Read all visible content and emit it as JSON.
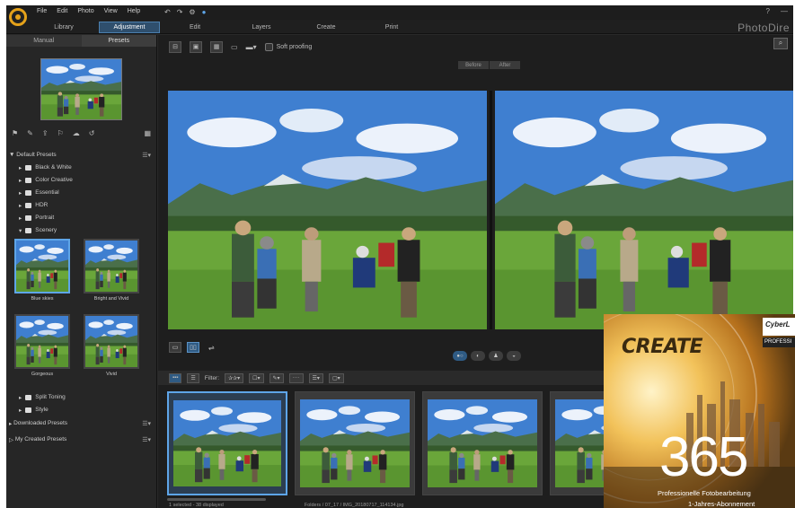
{
  "menu": {
    "items": [
      "File",
      "Edit",
      "Photo",
      "View",
      "Help"
    ],
    "icons": [
      "undo-icon",
      "redo-icon",
      "settings-icon",
      "update-icon"
    ],
    "window": [
      "?",
      "—"
    ]
  },
  "modes": {
    "items": [
      "Library",
      "Adjustment",
      "Edit",
      "Layers",
      "Create",
      "Print"
    ],
    "active": "Adjustment"
  },
  "brand": "PhotoDire",
  "left": {
    "tabs": [
      "Manual",
      "Presets"
    ],
    "active_tab": "Presets",
    "default_presets": "Default Presets",
    "tree": [
      "Black & White",
      "Color Creative",
      "Essential",
      "HDR",
      "Portrait",
      "Scenery"
    ],
    "thumbs": [
      {
        "caption": "Blue skies"
      },
      {
        "caption": "Bright and Vivid"
      },
      {
        "caption": "Gorgeous"
      },
      {
        "caption": "Vivid"
      }
    ],
    "tree2": [
      "Split Toning",
      "Style"
    ],
    "downloaded": "Downloaded Presets",
    "mycreated": "My Created Presets"
  },
  "toolbar": {
    "soft_proofing": "Soft proofing",
    "search_icon": "search-icon"
  },
  "before_after": {
    "before": "Before",
    "after": "After"
  },
  "filter": {
    "label": "Filter:"
  },
  "status": {
    "selected": "1 selected - 38 displayed",
    "path": "Folders / 07_17 / IMG_20180717_114134.jpg"
  },
  "box": {
    "title": "CREATE",
    "brand": "CyberL",
    "bar": "PROFESSI",
    "number": "365",
    "sub": "Professionelle Fotobearbeitung",
    "sub2": "1-Jahres-Abonnement"
  },
  "colors": {
    "accent": "#5ea5e8",
    "active_mode": "#2f4f6d",
    "logo": "#e5a21a"
  }
}
